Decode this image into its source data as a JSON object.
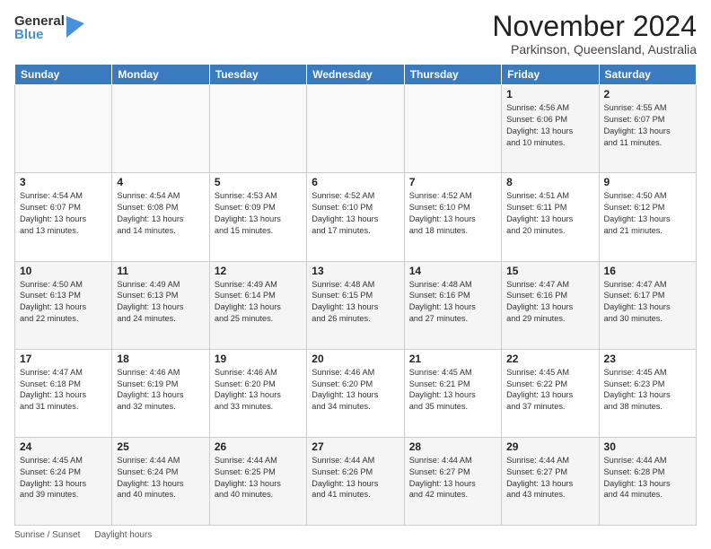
{
  "logo": {
    "general": "General",
    "blue": "Blue"
  },
  "title": "November 2024",
  "location": "Parkinson, Queensland, Australia",
  "days_of_week": [
    "Sunday",
    "Monday",
    "Tuesday",
    "Wednesday",
    "Thursday",
    "Friday",
    "Saturday"
  ],
  "footer": {
    "sunrise_label": "Sunrise / Sunset",
    "daylight_label": "Daylight hours"
  },
  "weeks": [
    [
      {
        "day": "",
        "info": ""
      },
      {
        "day": "",
        "info": ""
      },
      {
        "day": "",
        "info": ""
      },
      {
        "day": "",
        "info": ""
      },
      {
        "day": "",
        "info": ""
      },
      {
        "day": "1",
        "info": "Sunrise: 4:56 AM\nSunset: 6:06 PM\nDaylight: 13 hours\nand 10 minutes."
      },
      {
        "day": "2",
        "info": "Sunrise: 4:55 AM\nSunset: 6:07 PM\nDaylight: 13 hours\nand 11 minutes."
      }
    ],
    [
      {
        "day": "3",
        "info": "Sunrise: 4:54 AM\nSunset: 6:07 PM\nDaylight: 13 hours\nand 13 minutes."
      },
      {
        "day": "4",
        "info": "Sunrise: 4:54 AM\nSunset: 6:08 PM\nDaylight: 13 hours\nand 14 minutes."
      },
      {
        "day": "5",
        "info": "Sunrise: 4:53 AM\nSunset: 6:09 PM\nDaylight: 13 hours\nand 15 minutes."
      },
      {
        "day": "6",
        "info": "Sunrise: 4:52 AM\nSunset: 6:10 PM\nDaylight: 13 hours\nand 17 minutes."
      },
      {
        "day": "7",
        "info": "Sunrise: 4:52 AM\nSunset: 6:10 PM\nDaylight: 13 hours\nand 18 minutes."
      },
      {
        "day": "8",
        "info": "Sunrise: 4:51 AM\nSunset: 6:11 PM\nDaylight: 13 hours\nand 20 minutes."
      },
      {
        "day": "9",
        "info": "Sunrise: 4:50 AM\nSunset: 6:12 PM\nDaylight: 13 hours\nand 21 minutes."
      }
    ],
    [
      {
        "day": "10",
        "info": "Sunrise: 4:50 AM\nSunset: 6:13 PM\nDaylight: 13 hours\nand 22 minutes."
      },
      {
        "day": "11",
        "info": "Sunrise: 4:49 AM\nSunset: 6:13 PM\nDaylight: 13 hours\nand 24 minutes."
      },
      {
        "day": "12",
        "info": "Sunrise: 4:49 AM\nSunset: 6:14 PM\nDaylight: 13 hours\nand 25 minutes."
      },
      {
        "day": "13",
        "info": "Sunrise: 4:48 AM\nSunset: 6:15 PM\nDaylight: 13 hours\nand 26 minutes."
      },
      {
        "day": "14",
        "info": "Sunrise: 4:48 AM\nSunset: 6:16 PM\nDaylight: 13 hours\nand 27 minutes."
      },
      {
        "day": "15",
        "info": "Sunrise: 4:47 AM\nSunset: 6:16 PM\nDaylight: 13 hours\nand 29 minutes."
      },
      {
        "day": "16",
        "info": "Sunrise: 4:47 AM\nSunset: 6:17 PM\nDaylight: 13 hours\nand 30 minutes."
      }
    ],
    [
      {
        "day": "17",
        "info": "Sunrise: 4:47 AM\nSunset: 6:18 PM\nDaylight: 13 hours\nand 31 minutes."
      },
      {
        "day": "18",
        "info": "Sunrise: 4:46 AM\nSunset: 6:19 PM\nDaylight: 13 hours\nand 32 minutes."
      },
      {
        "day": "19",
        "info": "Sunrise: 4:46 AM\nSunset: 6:20 PM\nDaylight: 13 hours\nand 33 minutes."
      },
      {
        "day": "20",
        "info": "Sunrise: 4:46 AM\nSunset: 6:20 PM\nDaylight: 13 hours\nand 34 minutes."
      },
      {
        "day": "21",
        "info": "Sunrise: 4:45 AM\nSunset: 6:21 PM\nDaylight: 13 hours\nand 35 minutes."
      },
      {
        "day": "22",
        "info": "Sunrise: 4:45 AM\nSunset: 6:22 PM\nDaylight: 13 hours\nand 37 minutes."
      },
      {
        "day": "23",
        "info": "Sunrise: 4:45 AM\nSunset: 6:23 PM\nDaylight: 13 hours\nand 38 minutes."
      }
    ],
    [
      {
        "day": "24",
        "info": "Sunrise: 4:45 AM\nSunset: 6:24 PM\nDaylight: 13 hours\nand 39 minutes."
      },
      {
        "day": "25",
        "info": "Sunrise: 4:44 AM\nSunset: 6:24 PM\nDaylight: 13 hours\nand 40 minutes."
      },
      {
        "day": "26",
        "info": "Sunrise: 4:44 AM\nSunset: 6:25 PM\nDaylight: 13 hours\nand 40 minutes."
      },
      {
        "day": "27",
        "info": "Sunrise: 4:44 AM\nSunset: 6:26 PM\nDaylight: 13 hours\nand 41 minutes."
      },
      {
        "day": "28",
        "info": "Sunrise: 4:44 AM\nSunset: 6:27 PM\nDaylight: 13 hours\nand 42 minutes."
      },
      {
        "day": "29",
        "info": "Sunrise: 4:44 AM\nSunset: 6:27 PM\nDaylight: 13 hours\nand 43 minutes."
      },
      {
        "day": "30",
        "info": "Sunrise: 4:44 AM\nSunset: 6:28 PM\nDaylight: 13 hours\nand 44 minutes."
      }
    ]
  ]
}
